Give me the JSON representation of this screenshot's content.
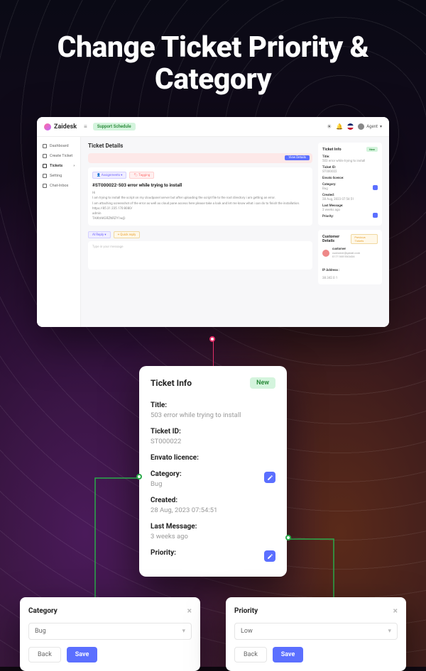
{
  "headline": "Change Ticket Priority & Category",
  "app": {
    "logo": "Zaidesk",
    "support_schedule": "Support Schedule",
    "agent_label": "Agent"
  },
  "sidebar": {
    "items": [
      {
        "label": "Dashboard"
      },
      {
        "label": "Create Ticket"
      },
      {
        "label": "Tickets"
      },
      {
        "label": "Setting"
      },
      {
        "label": "Chat-Inbox"
      }
    ]
  },
  "page": {
    "title": "Ticket Details",
    "view_details": "View Details",
    "assignments": "Assignments",
    "tagging": "Tagging",
    "ticket_title": "#ST000022-503 error while trying to install",
    "greeting": "Hi",
    "body1": "I am trying to install the script on my cloudpanel server but after uploading the script file to the root directory i am getting an error.",
    "body2": "I am attaching screenshot of the error as well as cloud pane access here please take a look and let me know what i can do to finish the installation.",
    "url": "https://85.31.235.170:8080/",
    "user": "admin",
    "token": "TAlKtAKGRZNRZY1w@",
    "ai_reply": "AI Reply",
    "quick_reply": "+ Quick reply",
    "reply_placeholder": "Type in your message"
  },
  "ticket_info_mini": {
    "heading": "Ticket Info",
    "new": "New",
    "title_label": "Title:",
    "title_val": "503 error while trying to install",
    "id_label": "Ticket ID:",
    "id_val": "ST000022",
    "licence_label": "Envato licence:",
    "category_label": "Category:",
    "category_val": "Bug",
    "created_label": "Created:",
    "created_val": "28 Aug, 2023 07:54:51",
    "lastmsg_label": "Last Message:",
    "lastmsg_val": "3 weeks ago",
    "priority_label": "Priority:"
  },
  "customer": {
    "heading": "Customer Details",
    "prev_btn": "Previous Tickets",
    "name": "customer",
    "email": "customer@gmail.com",
    "phone": "01711881543434",
    "ip_label": "IP Address :",
    "ip_val": "38.342.0.1"
  },
  "zoom": {
    "heading": "Ticket Info",
    "new": "New",
    "title_label": "Title:",
    "title_val": "503 error while trying to install",
    "id_label": "Ticket ID:",
    "id_val": "ST000022",
    "licence_label": "Envato licence:",
    "category_label": "Category:",
    "category_val": "Bug",
    "created_label": "Created:",
    "created_val": "28 Aug, 2023 07:54:51",
    "lastmsg_label": "Last Message:",
    "lastmsg_val": "3 weeks ago",
    "priority_label": "Priority:"
  },
  "popup_category": {
    "title": "Category",
    "value": "Bug",
    "back": "Back",
    "save": "Save"
  },
  "popup_priority": {
    "title": "Priority",
    "value": "Low",
    "back": "Back",
    "save": "Save"
  }
}
